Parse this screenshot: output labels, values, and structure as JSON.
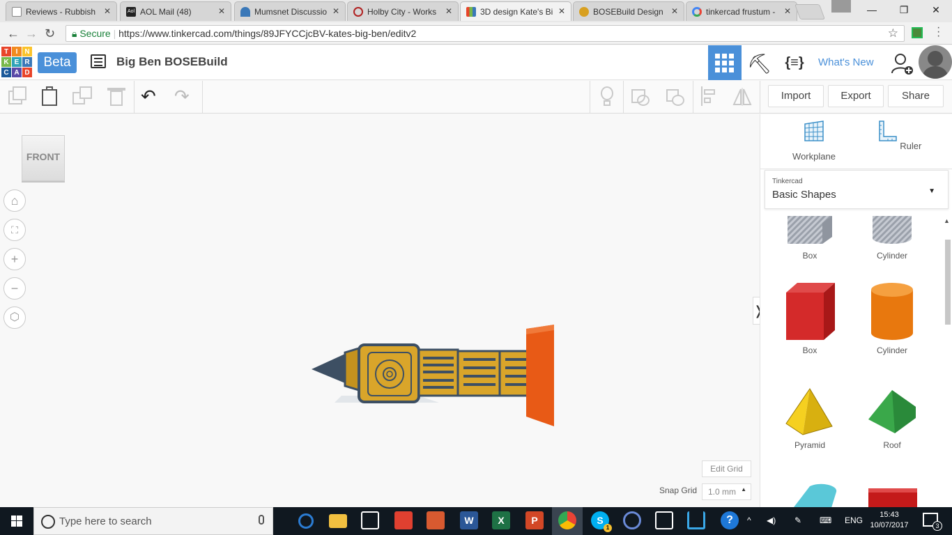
{
  "browser": {
    "tabs": [
      {
        "title": "Reviews - Rubbish",
        "icon": "doc-icon",
        "color": "#888888"
      },
      {
        "title": "AOL Mail (48)",
        "icon": "aol-icon",
        "color": "#222222"
      },
      {
        "title": "Mumsnet Discussio",
        "icon": "mumsnet-icon",
        "color": "#3a78b8"
      },
      {
        "title": "Holby City - Works",
        "icon": "holby-icon",
        "color": "#b02020"
      },
      {
        "title": "3D design Kate's Bi",
        "icon": "tinkercad-icon",
        "color": "#e8442a"
      },
      {
        "title": "BOSEBuild Design",
        "icon": "bose-icon",
        "color": "#d8a020"
      },
      {
        "title": "tinkercad frustum -",
        "icon": "google-icon",
        "color": "#4285f4"
      }
    ],
    "secure_label": "Secure",
    "url_prefix": "https://",
    "url_host": "www.tinkercad.com",
    "url_path": "/things/89JFYCCjcBV-kates-big-ben/editv2"
  },
  "app": {
    "logo": [
      "TIN",
      "KER",
      "CAD"
    ],
    "logo_colors": [
      "#e8442a",
      "#f28b20",
      "#fbc32b",
      "#78b84a",
      "#2fa3b8",
      "#3a78b8",
      "#1d5a9a",
      "#5a4aa8",
      "#e8442a"
    ],
    "beta_label": "Beta",
    "design_title": "Big Ben BOSEBuild",
    "whats_new": "What's New",
    "accent": "#4a90d9"
  },
  "toolbar": {
    "import": "Import",
    "export": "Export",
    "share": "Share"
  },
  "workplane": {
    "viewcube_label": "FRONT",
    "edit_grid": "Edit Grid",
    "snap_grid_label": "Snap Grid",
    "snap_grid_value": "1.0 mm"
  },
  "panel": {
    "workplane": "Workplane",
    "ruler": "Ruler",
    "library_category": "Tinkercad",
    "library_name": "Basic Shapes",
    "shapes": [
      {
        "label": "Box",
        "color": "#b8bcc4"
      },
      {
        "label": "Cylinder",
        "color": "#b8bcc4"
      },
      {
        "label": "Box",
        "color": "#d42a2a"
      },
      {
        "label": "Cylinder",
        "color": "#f28b20"
      },
      {
        "label": "Pyramid",
        "color": "#f5d020"
      },
      {
        "label": "Roof",
        "color": "#3aa84a"
      }
    ]
  },
  "taskbar": {
    "search_placeholder": "Type here to search",
    "language": "ENG",
    "time": "15:43",
    "date": "10/07/2017",
    "notifications": "3",
    "skype_badge": "1"
  }
}
